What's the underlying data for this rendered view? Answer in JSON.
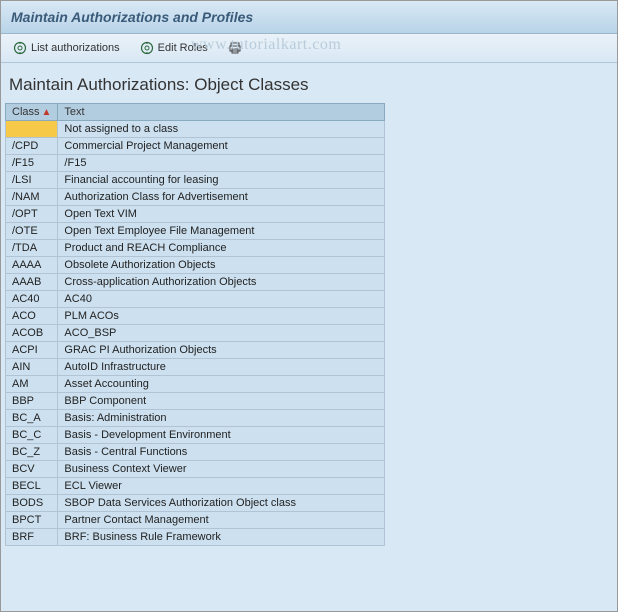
{
  "title": "Maintain Authorizations and Profiles",
  "toolbar": {
    "list_auth_label": "List authorizations",
    "edit_roles_label": "Edit Roles"
  },
  "watermark": "www.tutorialkart.com",
  "subtitle": "Maintain Authorizations: Object Classes",
  "columns": {
    "class": "Class",
    "text": "Text"
  },
  "rows": [
    {
      "class": "",
      "text": "Not assigned to a class",
      "selected": true
    },
    {
      "class": "/CPD",
      "text": "Commercial Project Management"
    },
    {
      "class": "/F15",
      "text": "/F15"
    },
    {
      "class": "/LSI",
      "text": "Financial accounting for leasing"
    },
    {
      "class": "/NAM",
      "text": "Authorization Class for Advertisement"
    },
    {
      "class": "/OPT",
      "text": "Open Text VIM"
    },
    {
      "class": "/OTE",
      "text": "Open Text Employee File Management"
    },
    {
      "class": "/TDA",
      "text": "Product and REACH Compliance"
    },
    {
      "class": "AAAA",
      "text": "Obsolete Authorization Objects"
    },
    {
      "class": "AAAB",
      "text": "Cross-application Authorization Objects"
    },
    {
      "class": "AC40",
      "text": "AC40"
    },
    {
      "class": "ACO",
      "text": "PLM ACOs"
    },
    {
      "class": "ACOB",
      "text": "ACO_BSP"
    },
    {
      "class": "ACPI",
      "text": "GRAC PI Authorization Objects"
    },
    {
      "class": "AIN",
      "text": "AutoID Infrastructure"
    },
    {
      "class": "AM",
      "text": "Asset Accounting"
    },
    {
      "class": "BBP",
      "text": "BBP Component"
    },
    {
      "class": "BC_A",
      "text": "Basis: Administration"
    },
    {
      "class": "BC_C",
      "text": "Basis - Development Environment"
    },
    {
      "class": "BC_Z",
      "text": "Basis - Central Functions"
    },
    {
      "class": "BCV",
      "text": "Business Context Viewer"
    },
    {
      "class": "BECL",
      "text": "ECL Viewer"
    },
    {
      "class": "BODS",
      "text": "SBOP Data Services Authorization Object class"
    },
    {
      "class": "BPCT",
      "text": "Partner Contact Management"
    },
    {
      "class": "BRF",
      "text": "BRF: Business Rule Framework"
    }
  ]
}
